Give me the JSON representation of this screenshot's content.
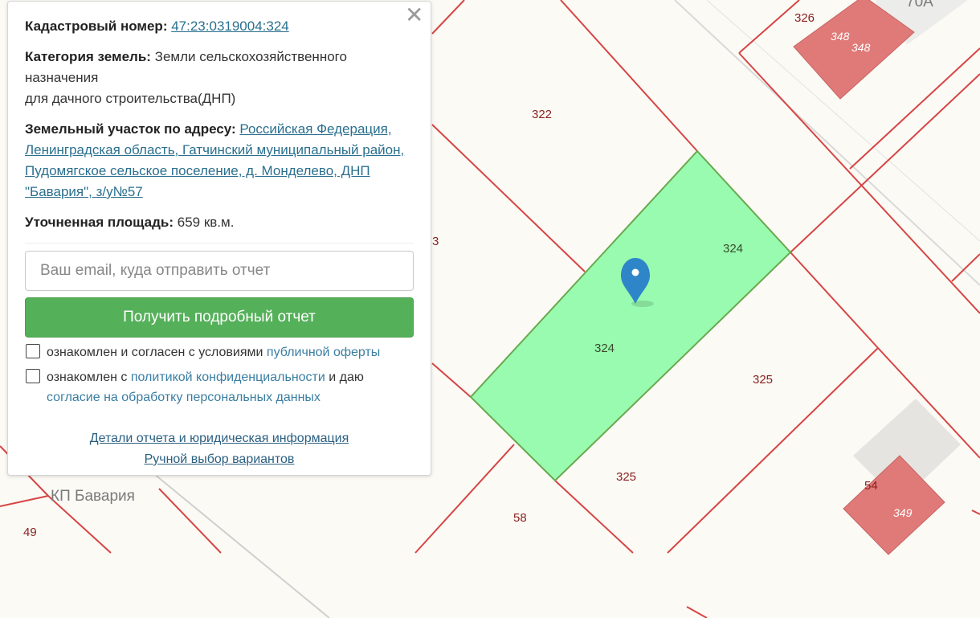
{
  "popup": {
    "cadastral_label": "Кадастровый номер:",
    "cadastral_number": "47:23:0319004:324",
    "category_label": "Категория земель:",
    "category_value_line1": "Земли сельскохозяйственного",
    "category_value_line2": "назначения",
    "category_value_line3": "для дачного строительства(ДНП)",
    "address_label": "Земельный участок по адресу:",
    "address_value": "Российская Федерация, Ленинградская область, Гатчинский муниципальный район, Пудомягское сельское поселение, д. Монделево, ДНП \"Бавария\", з/у№57",
    "area_label": "Уточненная площадь:",
    "area_value": "659 кв.м.",
    "email_placeholder": "Ваш email, куда отправить отчет",
    "submit_label": "Получить подробный отчет",
    "consent1_text": "ознакомлен и согласен с условиями",
    "consent1_link": "публичной оферты",
    "consent2_text_a": "ознакомлен с",
    "consent2_link_a": "политикой конфиденциальности",
    "consent2_text_b": "и даю",
    "consent2_link_b": "согласие на обработку персональных данных",
    "details_link": "Детали отчета и юридическая информация",
    "manual_link": "Ручной выбор вариантов",
    "close_icon": "✕"
  },
  "map": {
    "parcel_labels": {
      "p322": "322",
      "p324a": "324",
      "p324b": "324",
      "p325a": "325",
      "p325b": "325",
      "p326": "326",
      "p58": "58",
      "p49": "49",
      "p54": "54",
      "p3": "3",
      "p70a": "70А"
    },
    "building_labels": {
      "b348a": "348",
      "b348b": "348",
      "b349": "349"
    },
    "place_label": "КП Бавария",
    "colors": {
      "parcel_line": "#d64545",
      "selected_fill": "#98fbb0",
      "selected_stroke": "#6aa84f",
      "building_fill": "#e07a78",
      "marker": "#2e86c9"
    },
    "marker_icon": "map-pin-icon"
  }
}
